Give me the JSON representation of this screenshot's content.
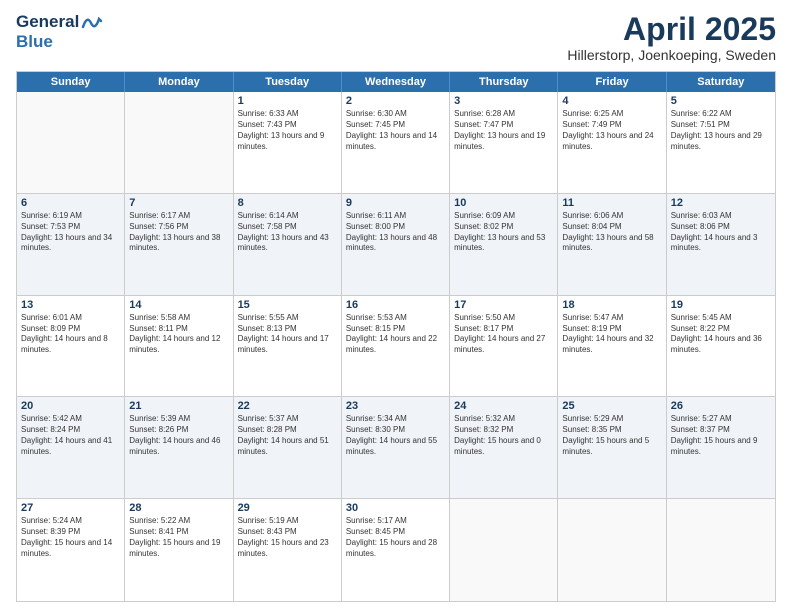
{
  "header": {
    "logo_line1": "General",
    "logo_line2": "Blue",
    "title": "April 2025",
    "location": "Hillerstorp, Joenkoeping, Sweden"
  },
  "weekdays": [
    "Sunday",
    "Monday",
    "Tuesday",
    "Wednesday",
    "Thursday",
    "Friday",
    "Saturday"
  ],
  "rows": [
    [
      {
        "day": "",
        "info": ""
      },
      {
        "day": "",
        "info": ""
      },
      {
        "day": "1",
        "info": "Sunrise: 6:33 AM\nSunset: 7:43 PM\nDaylight: 13 hours and 9 minutes."
      },
      {
        "day": "2",
        "info": "Sunrise: 6:30 AM\nSunset: 7:45 PM\nDaylight: 13 hours and 14 minutes."
      },
      {
        "day": "3",
        "info": "Sunrise: 6:28 AM\nSunset: 7:47 PM\nDaylight: 13 hours and 19 minutes."
      },
      {
        "day": "4",
        "info": "Sunrise: 6:25 AM\nSunset: 7:49 PM\nDaylight: 13 hours and 24 minutes."
      },
      {
        "day": "5",
        "info": "Sunrise: 6:22 AM\nSunset: 7:51 PM\nDaylight: 13 hours and 29 minutes."
      }
    ],
    [
      {
        "day": "6",
        "info": "Sunrise: 6:19 AM\nSunset: 7:53 PM\nDaylight: 13 hours and 34 minutes."
      },
      {
        "day": "7",
        "info": "Sunrise: 6:17 AM\nSunset: 7:56 PM\nDaylight: 13 hours and 38 minutes."
      },
      {
        "day": "8",
        "info": "Sunrise: 6:14 AM\nSunset: 7:58 PM\nDaylight: 13 hours and 43 minutes."
      },
      {
        "day": "9",
        "info": "Sunrise: 6:11 AM\nSunset: 8:00 PM\nDaylight: 13 hours and 48 minutes."
      },
      {
        "day": "10",
        "info": "Sunrise: 6:09 AM\nSunset: 8:02 PM\nDaylight: 13 hours and 53 minutes."
      },
      {
        "day": "11",
        "info": "Sunrise: 6:06 AM\nSunset: 8:04 PM\nDaylight: 13 hours and 58 minutes."
      },
      {
        "day": "12",
        "info": "Sunrise: 6:03 AM\nSunset: 8:06 PM\nDaylight: 14 hours and 3 minutes."
      }
    ],
    [
      {
        "day": "13",
        "info": "Sunrise: 6:01 AM\nSunset: 8:09 PM\nDaylight: 14 hours and 8 minutes."
      },
      {
        "day": "14",
        "info": "Sunrise: 5:58 AM\nSunset: 8:11 PM\nDaylight: 14 hours and 12 minutes."
      },
      {
        "day": "15",
        "info": "Sunrise: 5:55 AM\nSunset: 8:13 PM\nDaylight: 14 hours and 17 minutes."
      },
      {
        "day": "16",
        "info": "Sunrise: 5:53 AM\nSunset: 8:15 PM\nDaylight: 14 hours and 22 minutes."
      },
      {
        "day": "17",
        "info": "Sunrise: 5:50 AM\nSunset: 8:17 PM\nDaylight: 14 hours and 27 minutes."
      },
      {
        "day": "18",
        "info": "Sunrise: 5:47 AM\nSunset: 8:19 PM\nDaylight: 14 hours and 32 minutes."
      },
      {
        "day": "19",
        "info": "Sunrise: 5:45 AM\nSunset: 8:22 PM\nDaylight: 14 hours and 36 minutes."
      }
    ],
    [
      {
        "day": "20",
        "info": "Sunrise: 5:42 AM\nSunset: 8:24 PM\nDaylight: 14 hours and 41 minutes."
      },
      {
        "day": "21",
        "info": "Sunrise: 5:39 AM\nSunset: 8:26 PM\nDaylight: 14 hours and 46 minutes."
      },
      {
        "day": "22",
        "info": "Sunrise: 5:37 AM\nSunset: 8:28 PM\nDaylight: 14 hours and 51 minutes."
      },
      {
        "day": "23",
        "info": "Sunrise: 5:34 AM\nSunset: 8:30 PM\nDaylight: 14 hours and 55 minutes."
      },
      {
        "day": "24",
        "info": "Sunrise: 5:32 AM\nSunset: 8:32 PM\nDaylight: 15 hours and 0 minutes."
      },
      {
        "day": "25",
        "info": "Sunrise: 5:29 AM\nSunset: 8:35 PM\nDaylight: 15 hours and 5 minutes."
      },
      {
        "day": "26",
        "info": "Sunrise: 5:27 AM\nSunset: 8:37 PM\nDaylight: 15 hours and 9 minutes."
      }
    ],
    [
      {
        "day": "27",
        "info": "Sunrise: 5:24 AM\nSunset: 8:39 PM\nDaylight: 15 hours and 14 minutes."
      },
      {
        "day": "28",
        "info": "Sunrise: 5:22 AM\nSunset: 8:41 PM\nDaylight: 15 hours and 19 minutes."
      },
      {
        "day": "29",
        "info": "Sunrise: 5:19 AM\nSunset: 8:43 PM\nDaylight: 15 hours and 23 minutes."
      },
      {
        "day": "30",
        "info": "Sunrise: 5:17 AM\nSunset: 8:45 PM\nDaylight: 15 hours and 28 minutes."
      },
      {
        "day": "",
        "info": ""
      },
      {
        "day": "",
        "info": ""
      },
      {
        "day": "",
        "info": ""
      }
    ]
  ]
}
